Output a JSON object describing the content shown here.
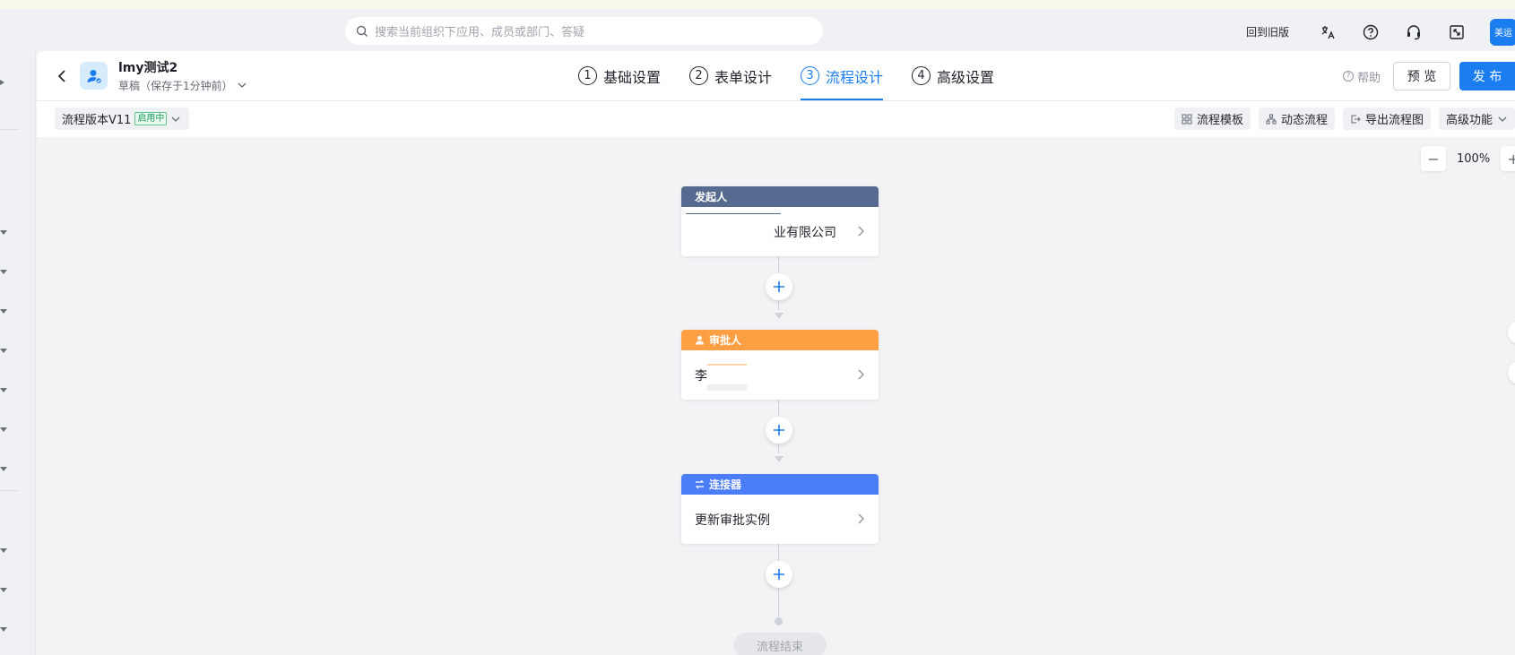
{
  "topbar": {
    "search_placeholder": "搜索当前组织下应用、成员或部门、答疑",
    "old_version": "回到旧版",
    "avatar_text": "美运"
  },
  "header": {
    "app_name": "lmy测试2",
    "draft_status": "草稿（保存于1分钟前）",
    "steps": [
      {
        "num": "1",
        "label": "基础设置"
      },
      {
        "num": "2",
        "label": "表单设计"
      },
      {
        "num": "3",
        "label": "流程设计"
      },
      {
        "num": "4",
        "label": "高级设置"
      }
    ],
    "active_step": 3,
    "help": "帮助",
    "preview": "预 览",
    "publish": "发 布"
  },
  "toolbar": {
    "version": "流程版本V11",
    "version_badge": "启用中",
    "tools": [
      "流程模板",
      "动态流程",
      "导出流程图",
      "高级功能"
    ]
  },
  "zoom": {
    "minus": "−",
    "value": "100%",
    "plus": "+"
  },
  "flow": {
    "nodes": [
      {
        "type": "发起人",
        "content": "业有限公司",
        "color": "#56698f"
      },
      {
        "type": "审批人",
        "content": "李",
        "color": "#ff9f44"
      },
      {
        "type": "连接器",
        "content": "更新审批实例",
        "color": "#4a7df7"
      }
    ],
    "end": "流程结束"
  },
  "colors": {
    "accent": "#1a7df0"
  }
}
